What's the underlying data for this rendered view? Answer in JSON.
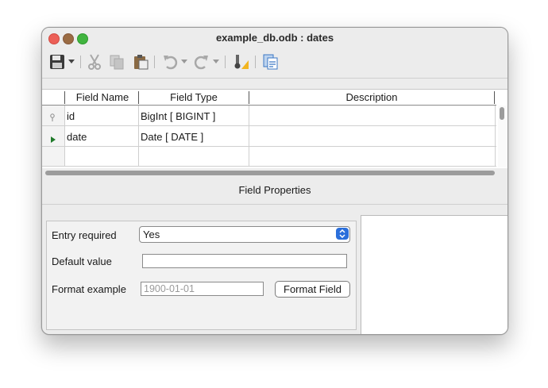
{
  "window": {
    "title": "example_db.odb : dates"
  },
  "toolbar": {
    "icons": [
      "save-icon",
      "cut-icon",
      "copy-icon",
      "paste-icon",
      "undo-icon",
      "redo-icon",
      "primary-key-icon",
      "index-design-icon"
    ]
  },
  "table": {
    "headers": [
      "Field Name",
      "Field Type",
      "Description"
    ],
    "rows": [
      {
        "name": "id",
        "type": "BigInt [ BIGINT ]",
        "description": ""
      },
      {
        "name": "date",
        "type": "Date [ DATE ]",
        "description": ""
      }
    ]
  },
  "field_properties": {
    "section_label": "Field Properties",
    "entry_required_label": "Entry required",
    "entry_required_value": "Yes",
    "default_value_label": "Default value",
    "default_value": "",
    "format_example_label": "Format example",
    "format_example_value": "1900-01-01",
    "format_field_button": "Format Field"
  },
  "colors": {
    "accent": "#2b6fdb"
  }
}
